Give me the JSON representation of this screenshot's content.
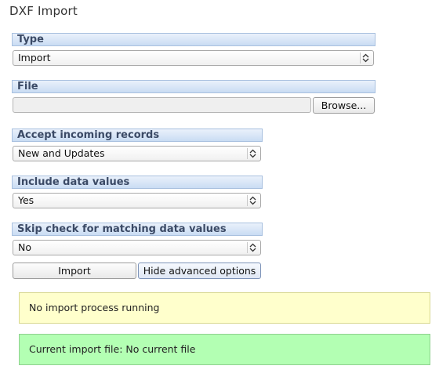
{
  "page": {
    "title": "DXF Import"
  },
  "type_section": {
    "header": "Type",
    "selected": "Import"
  },
  "file_section": {
    "header": "File",
    "browse_label": "Browse..."
  },
  "accept_section": {
    "header": "Accept incoming records",
    "selected": "New and Updates"
  },
  "data_values_section": {
    "header": "Include data values",
    "selected": "Yes"
  },
  "skip_check_section": {
    "header": "Skip check for matching data values",
    "selected": "No"
  },
  "actions": {
    "import_label": "Import",
    "advanced_label": "Hide advanced options"
  },
  "notices": {
    "process_status": "No import process running",
    "current_file": "Current import file: No current file"
  },
  "colors": {
    "section_header_text": "#3b4a66",
    "process_notice_bg": "#ffffcc",
    "file_notice_bg": "#b3ffb3"
  }
}
